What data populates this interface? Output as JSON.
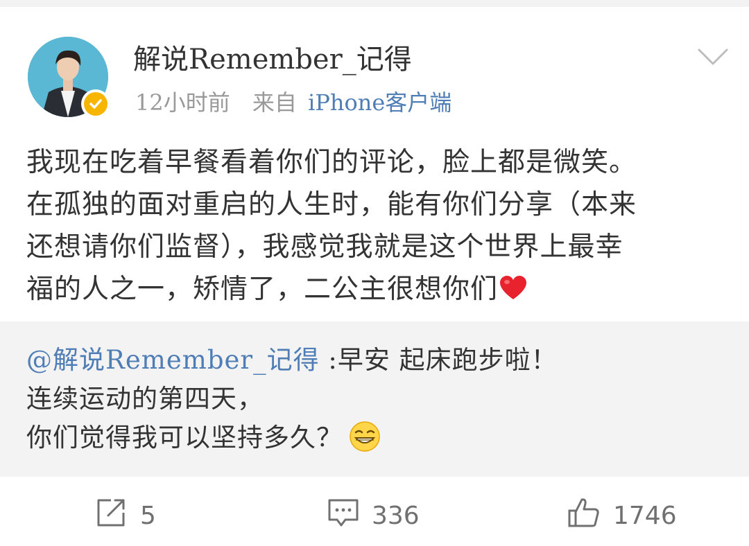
{
  "post": {
    "author": "解说Remember_记得",
    "time": "12小时前",
    "source_prefix": "来自",
    "source_client": "iPhone客户端",
    "lines": [
      "我现在吃着早餐看着你们的评论，脸上都是微笑。",
      "在孤独的面对重启的人生时，能有你们分享（本来",
      "还想请你们监督），我感觉我就是这个世界上最幸",
      "福的人之一，矫情了，二公主很想你们"
    ],
    "emoji": "red-heart"
  },
  "repost": {
    "mention": "@解说Remember_记得",
    "first_line_rest": " :早安 起床跑步啦！",
    "line2": "连续运动的第四天，",
    "line3": "你们觉得我可以坚持多久？",
    "emoji": "grinning-smile"
  },
  "actions": {
    "repost_count": "5",
    "comment_count": "336",
    "like_count": "1746"
  },
  "colors": {
    "link": "#4f7db5",
    "meta_gray": "#999999",
    "badge": "#f7b500",
    "heart": "#e8232d"
  }
}
